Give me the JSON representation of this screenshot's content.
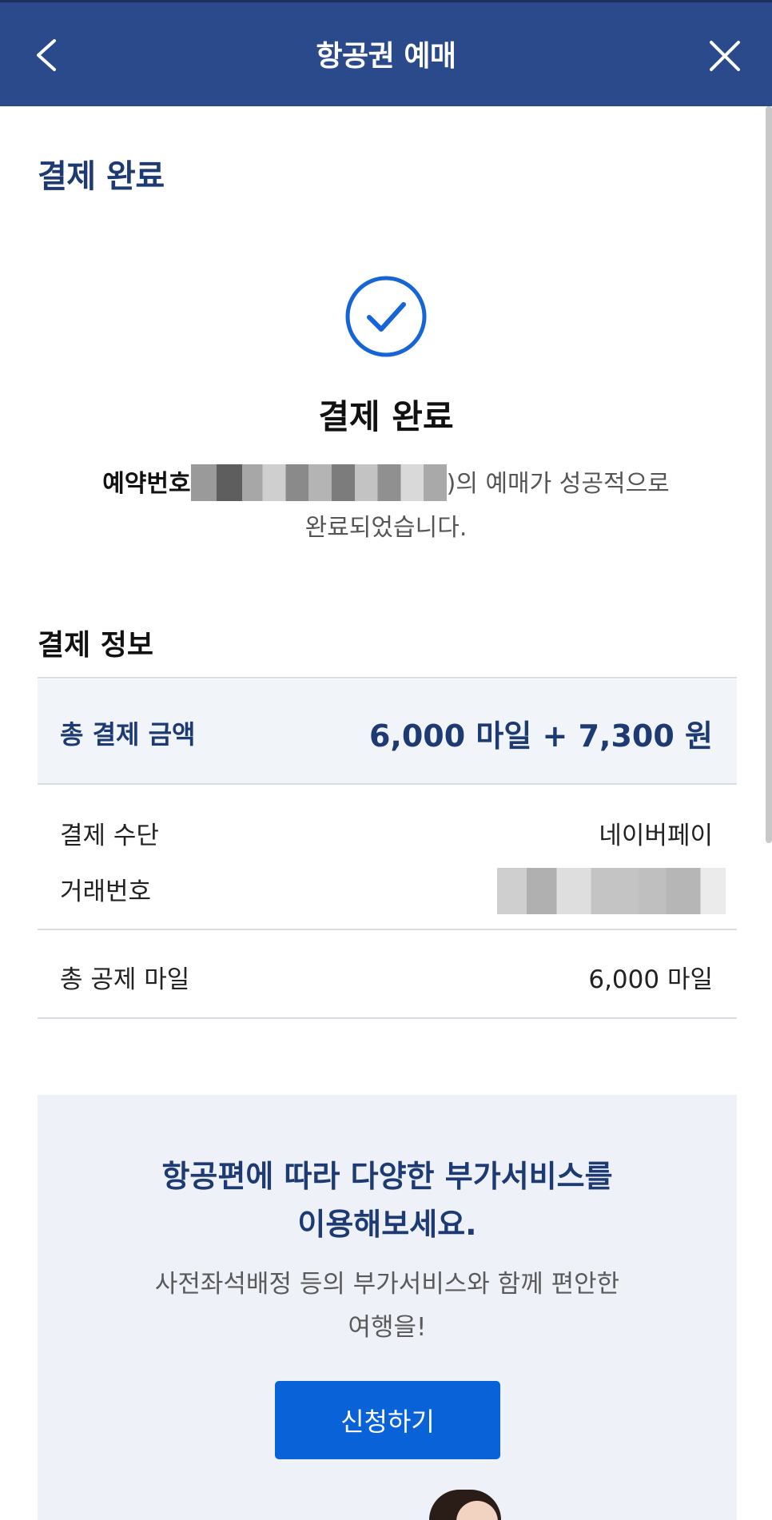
{
  "header": {
    "title": "항공권 예매",
    "back_icon": "chevron-left-icon",
    "close_icon": "close-icon",
    "background_color": "#2b4a8c"
  },
  "page": {
    "heading": "결제 완료"
  },
  "result": {
    "icon": "check-circle-icon",
    "title": "결제 완료",
    "reservation_label": "예약번호",
    "message_suffix": ")의 예매가 성공적으로",
    "message_line2": "완료되었습니다."
  },
  "payment": {
    "section_title": "결제 정보",
    "total_label": "총 결제 금액",
    "total_value": "6,000 마일 + 7,300 원",
    "method_label": "결제 수단",
    "method_value": "네이버페이",
    "transaction_label": "거래번호",
    "miles_label": "총 공제 마일",
    "miles_value": "6,000 마일"
  },
  "promo": {
    "headline_line1": "항공편에 따라 다양한 부가서비스를",
    "headline_line2": "이용해보세요.",
    "sub_line1": "사전좌석배정 등의 부가서비스와 함께 편안한",
    "sub_line2": "여행을!",
    "button_label": "신청하기",
    "button_color": "#0a62d8"
  }
}
